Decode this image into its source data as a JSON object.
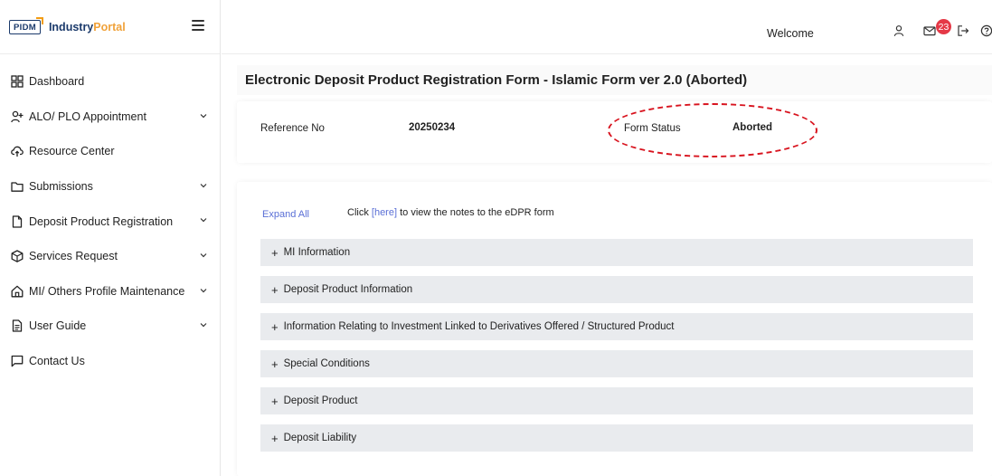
{
  "brand": {
    "logo_text": "PIDM",
    "name_part1": "Industry",
    "name_part2": "Portal"
  },
  "sidebar": {
    "items": [
      {
        "label": "Dashboard",
        "icon": "dashboard-grid-icon",
        "has_submenu": false
      },
      {
        "label": "ALO/ PLO Appointment",
        "icon": "user-add-icon",
        "has_submenu": true
      },
      {
        "label": "Resource Center",
        "icon": "cloud-upload-icon",
        "has_submenu": false
      },
      {
        "label": "Submissions",
        "icon": "folder-icon",
        "has_submenu": true
      },
      {
        "label": "Deposit Product Registration",
        "icon": "document-icon",
        "has_submenu": true
      },
      {
        "label": "Services Request",
        "icon": "package-icon",
        "has_submenu": true
      },
      {
        "label": "MI/ Others Profile Maintenance",
        "icon": "home-icon",
        "has_submenu": true
      },
      {
        "label": "User Guide",
        "icon": "guide-document-icon",
        "has_submenu": true
      },
      {
        "label": "Contact Us",
        "icon": "message-icon",
        "has_submenu": false
      }
    ]
  },
  "header": {
    "welcome": "Welcome",
    "notification_count": "23",
    "icons": [
      "user-icon",
      "mail-icon",
      "logout-icon",
      "help-icon"
    ]
  },
  "main": {
    "title": "Electronic Deposit Product Registration Form - Islamic Form ver 2.0 (Aborted)",
    "reference_label": "Reference No",
    "reference_value": "20250234",
    "status_label": "Form Status",
    "status_value": "Aborted",
    "expand_all": "Expand All",
    "note_prefix": "Click ",
    "note_link": "[here]",
    "note_suffix": " to view the notes to the eDPR form",
    "sections": [
      {
        "label": "MI Information"
      },
      {
        "label": "Deposit Product Information"
      },
      {
        "label": "Information Relating to Investment Linked to Derivatives Offered / Structured Product"
      },
      {
        "label": "Special Conditions"
      },
      {
        "label": "Deposit Product"
      },
      {
        "label": "Deposit Liability"
      }
    ]
  },
  "colors": {
    "accent_link": "#5a6fd6",
    "badge": "#e53947",
    "highlight_dash": "#d8131e",
    "brand_navy": "#1b3a6b",
    "brand_orange": "#f0a23a"
  }
}
